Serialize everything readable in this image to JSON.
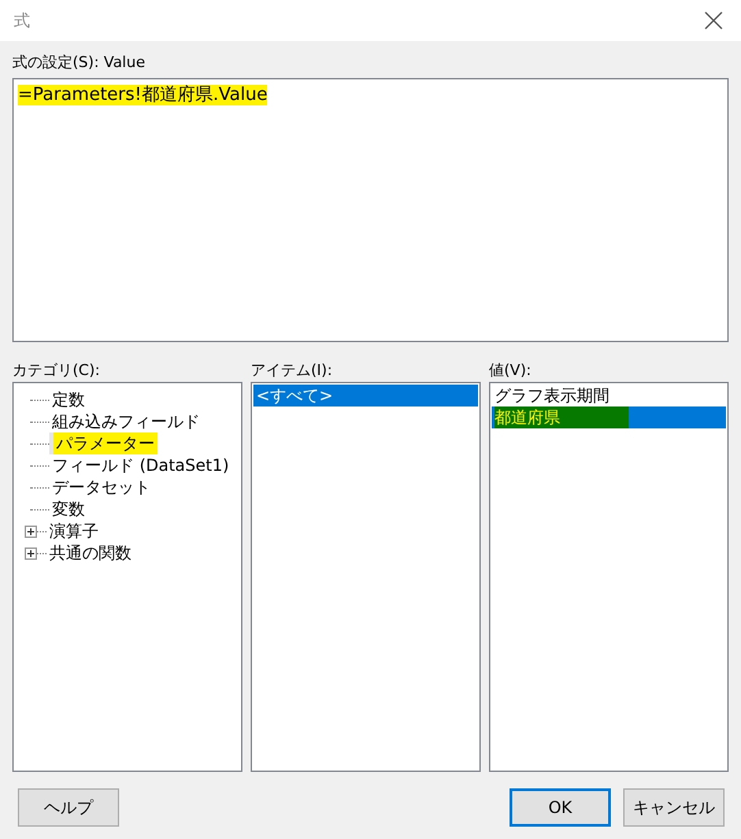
{
  "window": {
    "title": "式"
  },
  "expression": {
    "label": "式の設定(S): Value",
    "text": "=Parameters!都道府県.Value",
    "highlighted": true
  },
  "category": {
    "label": "カテゴリ(C):",
    "items": [
      {
        "label": "定数",
        "kind": "leaf",
        "selected": false,
        "highlighted": false
      },
      {
        "label": "組み込みフィールド",
        "kind": "leaf",
        "selected": false,
        "highlighted": false
      },
      {
        "label": "パラメーター",
        "kind": "leaf",
        "selected": true,
        "highlighted": true
      },
      {
        "label": "フィールド (DataSet1)",
        "kind": "leaf",
        "selected": false,
        "highlighted": false
      },
      {
        "label": "データセット",
        "kind": "leaf",
        "selected": false,
        "highlighted": false
      },
      {
        "label": "変数",
        "kind": "leaf",
        "selected": false,
        "highlighted": false
      },
      {
        "label": "演算子",
        "kind": "folder",
        "selected": false,
        "highlighted": false
      },
      {
        "label": "共通の関数",
        "kind": "folder",
        "selected": false,
        "highlighted": false
      }
    ]
  },
  "items": {
    "label": "アイテム(I):",
    "items": [
      {
        "label": "<すべて>",
        "selected": true,
        "highlighted": false
      }
    ]
  },
  "values": {
    "label": "値(V):",
    "items": [
      {
        "label": "グラフ表示期間",
        "selected": false,
        "highlighted": false
      },
      {
        "label": "都道府県",
        "selected": true,
        "highlighted": true
      }
    ]
  },
  "buttons": [
    {
      "label": "ヘルプ",
      "kind": "help",
      "default": false
    },
    {
      "label": "OK",
      "kind": "ok",
      "default": true
    },
    {
      "label": "キャンセル",
      "kind": "cancel",
      "default": false
    }
  ]
}
